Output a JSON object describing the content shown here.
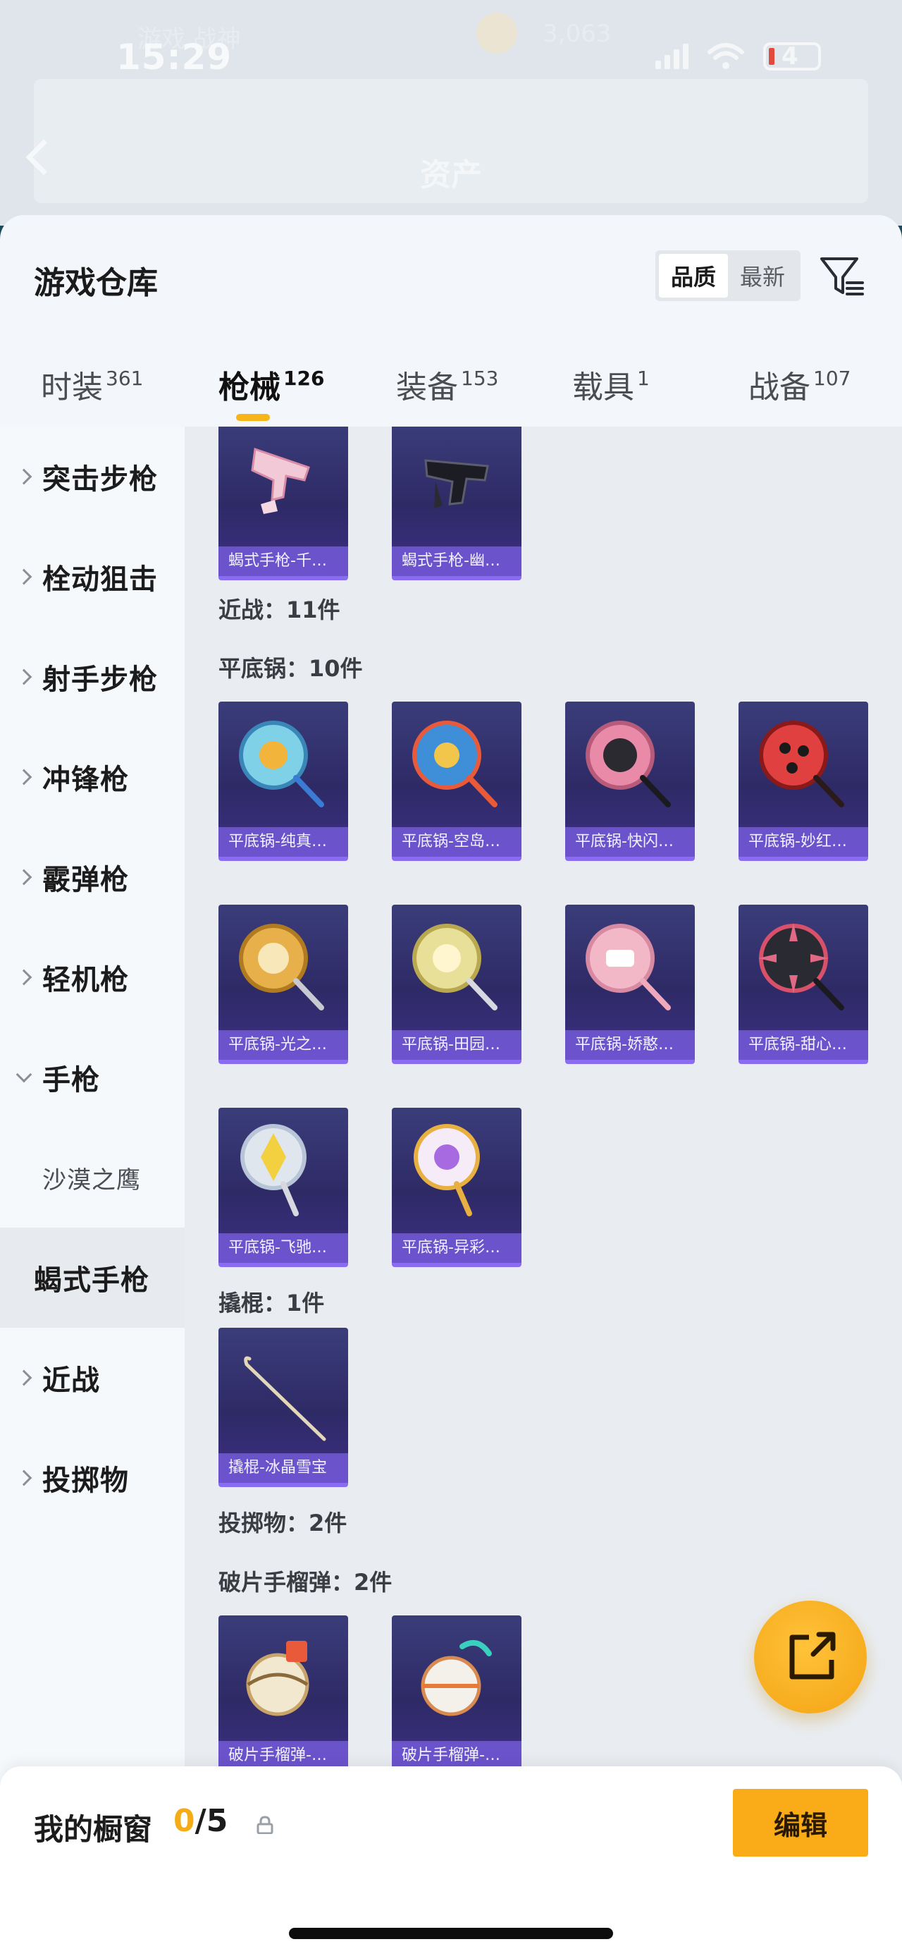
{
  "status_bar": {
    "time": "15:29",
    "battery": "4"
  },
  "background": {
    "faded_text": "游戏 战神",
    "faded_number": "3,063",
    "nav_title": "资产"
  },
  "sheet": {
    "title": "游戏仓库",
    "sort": {
      "quality": "品质",
      "newest": "最新",
      "active": "quality"
    },
    "filter_icon": "filter-icon"
  },
  "category_tabs": [
    {
      "label": "时装",
      "count": "361"
    },
    {
      "label": "枪械",
      "count": "126",
      "active": true
    },
    {
      "label": "装备",
      "count": "153"
    },
    {
      "label": "载具",
      "count": "1"
    },
    {
      "label": "战备",
      "count": "107"
    }
  ],
  "sidebar": {
    "items": [
      {
        "label": "突击步枪"
      },
      {
        "label": "栓动狙击"
      },
      {
        "label": "射手步枪"
      },
      {
        "label": "冲锋枪"
      },
      {
        "label": "霰弹枪"
      },
      {
        "label": "轻机枪"
      },
      {
        "label": "手枪",
        "expanded": true
      },
      {
        "label": "沙漠之鹰"
      },
      {
        "label": "蝎式手枪",
        "selected": true
      },
      {
        "label": "近战"
      },
      {
        "label": "投掷物"
      }
    ]
  },
  "content": {
    "scorpion_cards": [
      {
        "name": "蝎式手枪-千…"
      },
      {
        "name": "蝎式手枪-幽…"
      }
    ],
    "melee_header": "近战：11件",
    "pan_header": "平底锅：10件",
    "pan_cards": [
      {
        "name": "平底锅-纯真…"
      },
      {
        "name": "平底锅-空岛…"
      },
      {
        "name": "平底锅-快闪…"
      },
      {
        "name": "平底锅-妙红…"
      },
      {
        "name": "平底锅-光之…"
      },
      {
        "name": "平底锅-田园…"
      },
      {
        "name": "平底锅-娇憨…"
      },
      {
        "name": "平底锅-甜心…"
      },
      {
        "name": "平底锅-飞驰…"
      },
      {
        "name": "平底锅-异彩…"
      }
    ],
    "crowbar_header": "撬棍：1件",
    "crowbar_cards": [
      {
        "name": "撬棍-冰晶雪宝"
      }
    ],
    "throw_header": "投掷物：2件",
    "grenade_header": "破片手榴弹：2件",
    "grenade_cards": [
      {
        "name": "破片手榴弹-…"
      },
      {
        "name": "破片手榴弹-…"
      }
    ]
  },
  "fab_icon": "share-external-icon",
  "bottom_bar": {
    "title": "我的橱窗",
    "count_current": "0",
    "count_rest": "/5",
    "edit_label": "编辑"
  },
  "colors": {
    "accent": "#f9ac18",
    "card_bg": "#2e2a66",
    "card_band": "#7c60e6"
  }
}
